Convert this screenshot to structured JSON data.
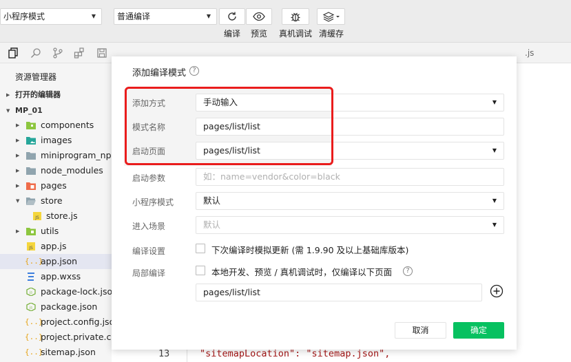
{
  "toolbar": {
    "mode_select": "小程序模式",
    "compile_select": "普通编译",
    "buttons": [
      {
        "label": "编译",
        "icon": "refresh-icon"
      },
      {
        "label": "预览",
        "icon": "eye-icon"
      },
      {
        "label": "真机调试",
        "icon": "bug-icon"
      },
      {
        "label": "清缓存",
        "icon": "layers-icon"
      }
    ]
  },
  "editor": {
    "tab_tail": ".js",
    "line_number": "13",
    "code_line": "\"sitemapLocation\": \"sitemap.json\","
  },
  "sidebar": {
    "title": "资源管理器",
    "section_open_editors": "打开的编辑器",
    "section_project": "MP_01",
    "items": [
      {
        "label": "components",
        "type": "folder"
      },
      {
        "label": "images",
        "type": "folder"
      },
      {
        "label": "miniprogram_npm",
        "type": "folder"
      },
      {
        "label": "node_modules",
        "type": "folder"
      },
      {
        "label": "pages",
        "type": "folder"
      },
      {
        "label": "store",
        "type": "folder-open"
      },
      {
        "label": "store.js",
        "type": "js"
      },
      {
        "label": "utils",
        "type": "folder"
      },
      {
        "label": "app.js",
        "type": "js"
      },
      {
        "label": "app.json",
        "type": "json",
        "selected": true
      },
      {
        "label": "app.wxss",
        "type": "wxss"
      },
      {
        "label": "package-lock.json",
        "type": "npm"
      },
      {
        "label": "package.json",
        "type": "npm"
      },
      {
        "label": "project.config.json",
        "type": "json"
      },
      {
        "label": "project.private.config.json",
        "type": "json"
      },
      {
        "label": "sitemap.json",
        "type": "json"
      }
    ]
  },
  "modal": {
    "title": "添加编译模式",
    "fields": {
      "add_method": {
        "label": "添加方式",
        "value": "手动输入"
      },
      "mode_name": {
        "label": "模式名称",
        "value": "pages/list/list"
      },
      "start_page": {
        "label": "启动页面",
        "value": "pages/list/list"
      },
      "start_params": {
        "label": "启动参数",
        "placeholder": "如：name=vendor&color=black"
      },
      "mp_mode": {
        "label": "小程序模式",
        "value": "默认"
      },
      "scene": {
        "label": "进入场景",
        "placeholder": "默认"
      },
      "compile_settings": {
        "label": "编译设置",
        "checkbox_text": "下次编译时模拟更新 (需 1.9.90 及以上基础库版本)"
      },
      "partial_compile": {
        "label": "局部编译",
        "checkbox_text": "本地开发、预览 / 真机调试时，仅编译以下页面",
        "page_value": "pages/list/list"
      }
    },
    "cancel_label": "取消",
    "ok_label": "确定"
  },
  "colors": {
    "accent_green": "#07c160",
    "highlight_red": "#ea1c1c"
  }
}
